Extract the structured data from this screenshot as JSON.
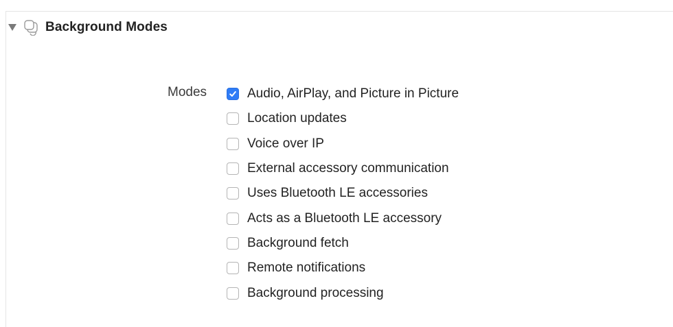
{
  "section": {
    "title": "Background Modes",
    "expanded": true,
    "icon": "capability-icon"
  },
  "modes": {
    "label": "Modes",
    "items": [
      {
        "label": "Audio, AirPlay, and Picture in Picture",
        "checked": true
      },
      {
        "label": "Location updates",
        "checked": false
      },
      {
        "label": "Voice over IP",
        "checked": false
      },
      {
        "label": "External accessory communication",
        "checked": false
      },
      {
        "label": "Uses Bluetooth LE accessories",
        "checked": false
      },
      {
        "label": "Acts as a Bluetooth LE accessory",
        "checked": false
      },
      {
        "label": "Background fetch",
        "checked": false
      },
      {
        "label": "Remote notifications",
        "checked": false
      },
      {
        "label": "Background processing",
        "checked": false
      }
    ]
  },
  "colors": {
    "accent": "#2f7cf6",
    "border": "#e4e4e4"
  }
}
